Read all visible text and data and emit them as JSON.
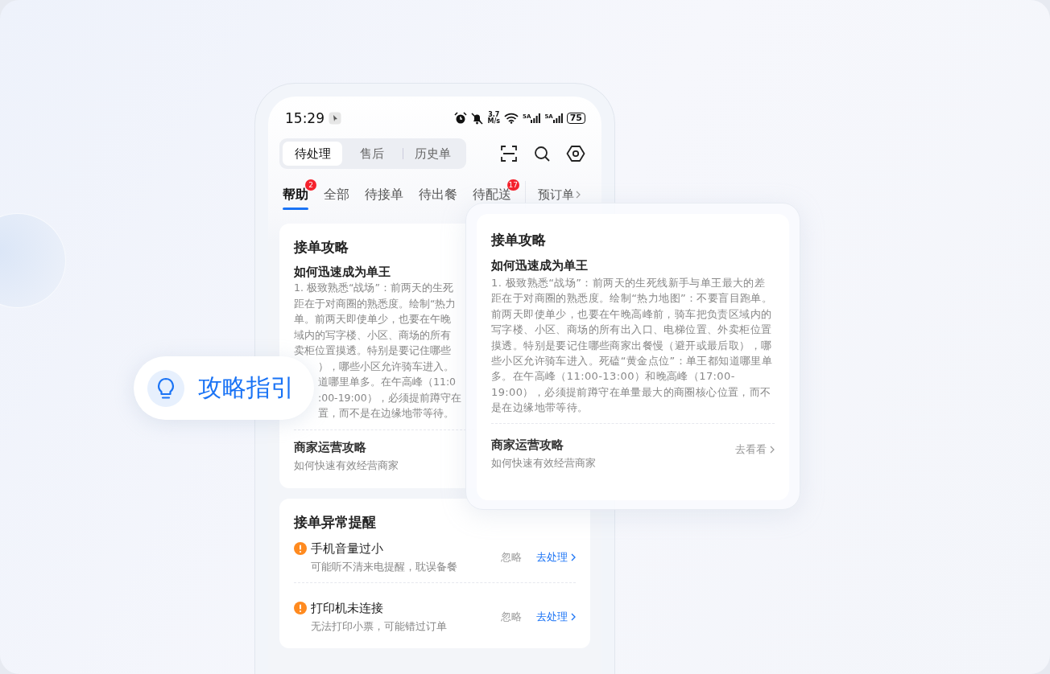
{
  "status_bar": {
    "time": "15:29",
    "speed_value": "3.7",
    "speed_unit": "M/s",
    "sim_labels": [
      "5A",
      "5A"
    ],
    "battery": "75"
  },
  "segment_tabs": [
    {
      "label": "待处理",
      "selected": true
    },
    {
      "label": "售后",
      "selected": false
    },
    {
      "label": "历史单",
      "selected": false
    }
  ],
  "order_tabs": [
    {
      "label": "帮助",
      "selected": true,
      "badge": "2"
    },
    {
      "label": "全部",
      "selected": false
    },
    {
      "label": "待接单",
      "selected": false
    },
    {
      "label": "待出餐",
      "selected": false
    },
    {
      "label": "待配送",
      "selected": false,
      "badge": "17"
    }
  ],
  "pinned_tab": {
    "label": "预订单"
  },
  "guide_card": {
    "title": "接单攻略",
    "article_title": "如何迅速成为单王",
    "body_lines": [
      {
        "text": "1. 极致熟悉“战场”：前两天的生死",
        "behind_pill": false
      },
      {
        "text": "距在于对商圈的熟悉度。绘制“热力",
        "behind_pill": false
      },
      {
        "text": "单。前两天即使单少，也要在午晚",
        "behind_pill": false
      },
      {
        "text": "域内的写字楼、小区、商场的所有",
        "behind_pill": false
      },
      {
        "text": "卖柜位置摸透。特别是要记住哪些",
        "behind_pill": false
      },
      {
        "text": "），哪些小区允许骑车进入。",
        "behind_pill": true
      },
      {
        "text": "道哪里单多。在午高峰（11:0",
        "behind_pill": true
      },
      {
        "text": ":00-19:00），必须提前蹲守在",
        "behind_pill": true
      },
      {
        "text": "置，而不是在边缘地带等待。",
        "behind_pill": true
      }
    ],
    "section": {
      "title": "商家运营攻略",
      "subtitle": "如何快速有效经营商家"
    }
  },
  "alert_card": {
    "title": "接单异常提醒",
    "items": [
      {
        "title": "手机音量过小",
        "subtitle": "可能听不清来电提醒，耽误备餐",
        "ignore": "忽略",
        "action": "去处理"
      },
      {
        "title": "打印机未连接",
        "subtitle": "无法打印小票，可能错过订单",
        "ignore": "忽略",
        "action": "去处理"
      }
    ]
  },
  "popup_card": {
    "title": "接单攻略",
    "article_title": "如何迅速成为单王",
    "body": "1. 极致熟悉“战场”：前两天的生死线新手与单王最大的差距在于对商圈的熟悉度。绘制“热力地图”：不要盲目跑单。前两天即使单少，也要在午晚高峰前，骑车把负责区域内的写字楼、小区、商场的所有出入口、电梯位置、外卖柜位置摸透。特别是要记住哪些商家出餐慢（避开或最后取），哪些小区允许骑车进入。死磕“黄金点位”：单王都知道哪里单多。在午高峰（11:00-13:00）和晚高峰（17:00-19:00），必须提前蹲守在单量最大的商圈核心位置，而不是在边缘地带等待。",
    "section": {
      "title": "商家运营攻略",
      "subtitle": "如何快速有效经营商家",
      "link": "去看看"
    }
  },
  "guide_pill": {
    "label": "攻略指引"
  }
}
